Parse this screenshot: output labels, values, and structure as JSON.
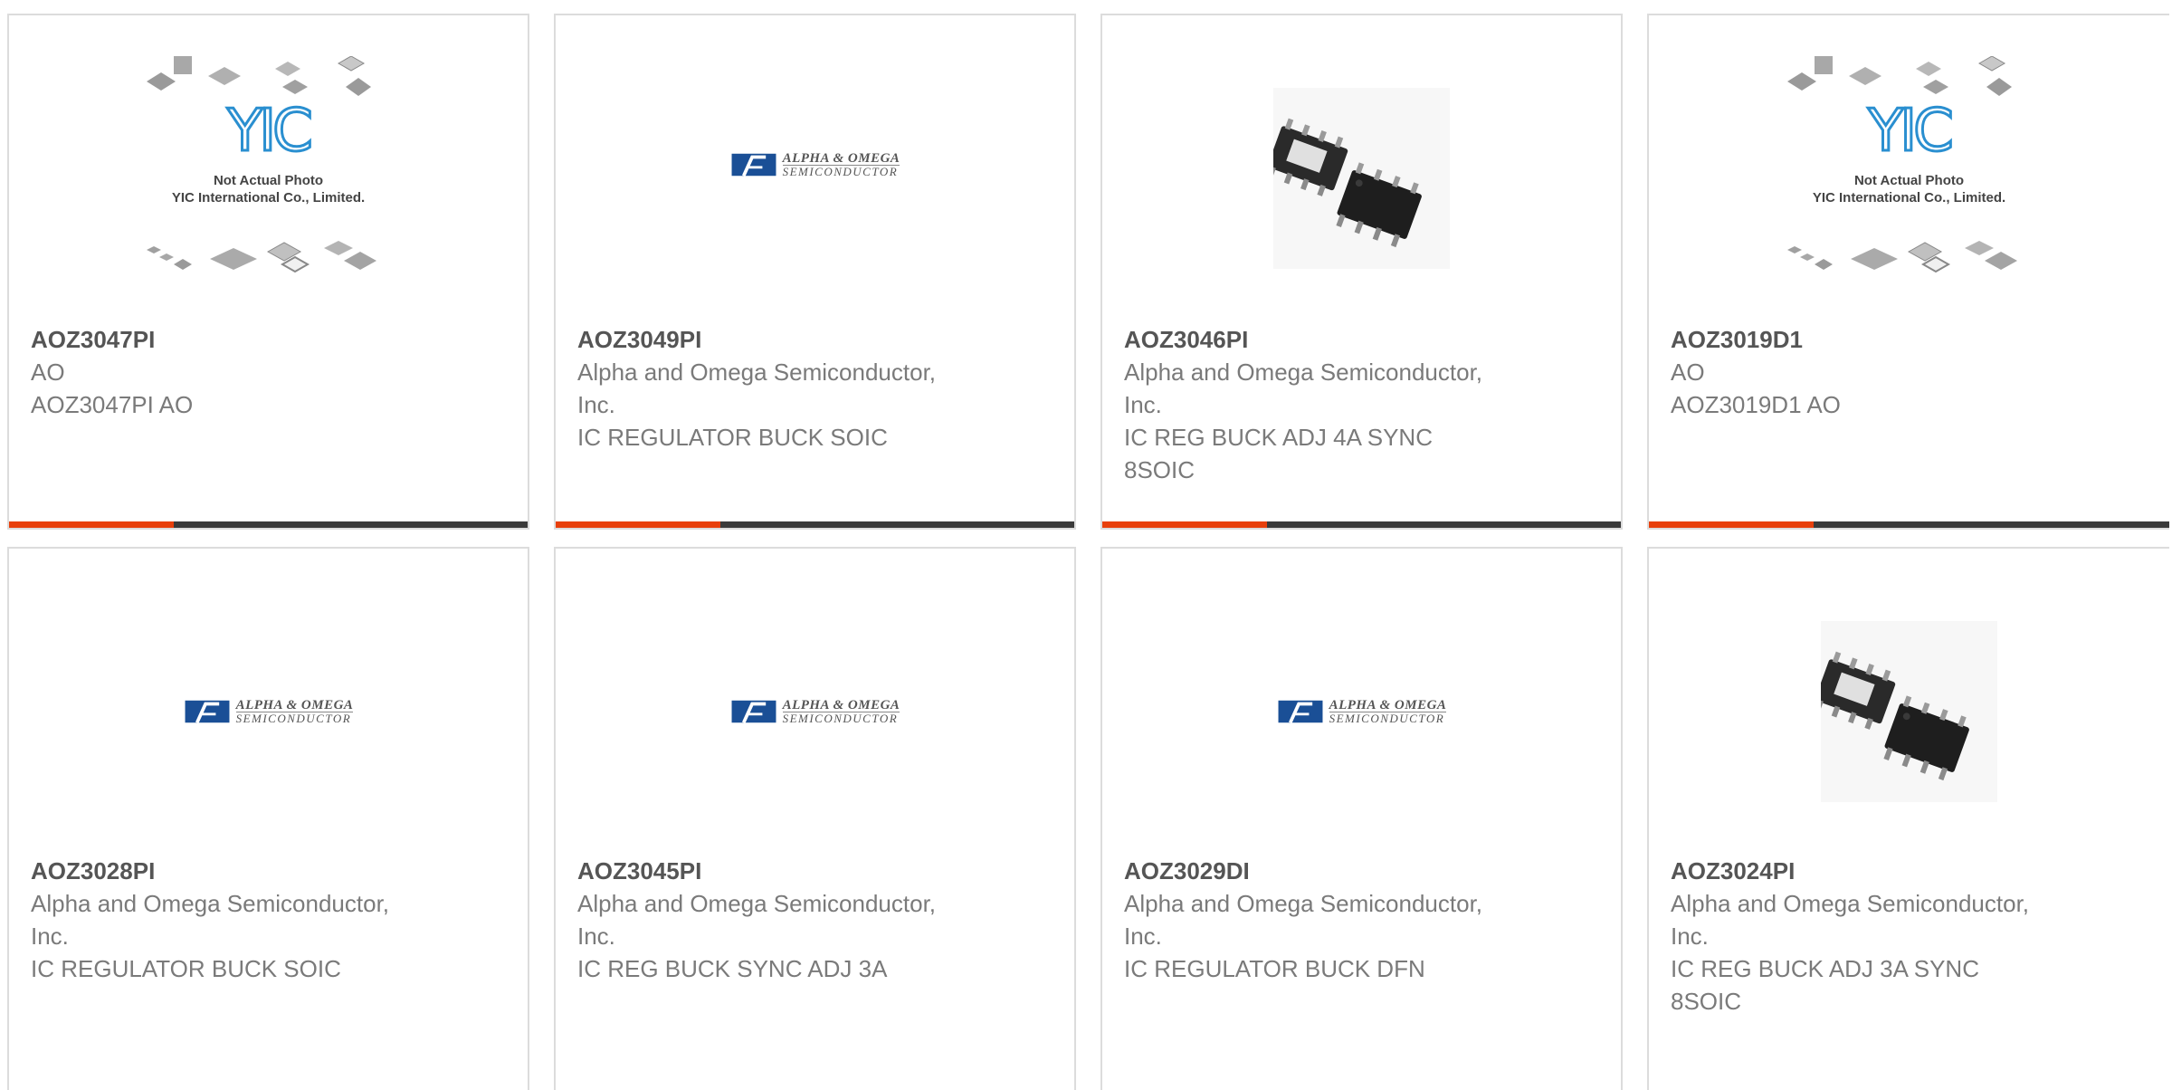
{
  "placeholder": {
    "brand": "YIC",
    "line1": "Not Actual Photo",
    "line2": "YIC International Co., Limited."
  },
  "logo": {
    "line1": "ALPHA & OMEGA",
    "line2": "SEMICONDUCTOR"
  },
  "colors": {
    "accent": "#e8400c",
    "bar": "#3a3a3a",
    "part_number": "#555555",
    "text": "#7a7a7a",
    "border": "#dcdcdc",
    "logo_blue": "#1a4f96"
  },
  "products": [
    {
      "part_number": "AOZ3047PI",
      "manufacturer": "AO",
      "description": "AOZ3047PI AO",
      "image": "yic-placeholder"
    },
    {
      "part_number": "AOZ3049PI",
      "manufacturer": "Alpha and Omega Semiconductor, Inc.",
      "description": "IC REGULATOR BUCK SOIC",
      "image": "alpha-omega-logo"
    },
    {
      "part_number": "AOZ3046PI",
      "manufacturer": "Alpha and Omega Semiconductor, Inc.",
      "description": "IC REG BUCK ADJ 4A SYNC 8SOIC",
      "image": "soic8-photo"
    },
    {
      "part_number": "AOZ3019D1",
      "manufacturer": "AO",
      "description": "AOZ3019D1 AO",
      "image": "yic-placeholder"
    },
    {
      "part_number": "AOZ3028PI",
      "manufacturer": "Alpha and Omega Semiconductor, Inc.",
      "description": "IC REGULATOR BUCK SOIC",
      "image": "alpha-omega-logo"
    },
    {
      "part_number": "AOZ3045PI",
      "manufacturer": "Alpha and Omega Semiconductor, Inc.",
      "description": "IC REG BUCK SYNC ADJ 3A",
      "image": "alpha-omega-logo"
    },
    {
      "part_number": "AOZ3029DI",
      "manufacturer": "Alpha and Omega Semiconductor, Inc.",
      "description": "IC REGULATOR BUCK DFN",
      "image": "alpha-omega-logo"
    },
    {
      "part_number": "AOZ3024PI",
      "manufacturer": "Alpha and Omega Semiconductor, Inc.",
      "description": "IC REG BUCK ADJ 3A SYNC 8SOIC",
      "image": "soic8-photo"
    }
  ]
}
